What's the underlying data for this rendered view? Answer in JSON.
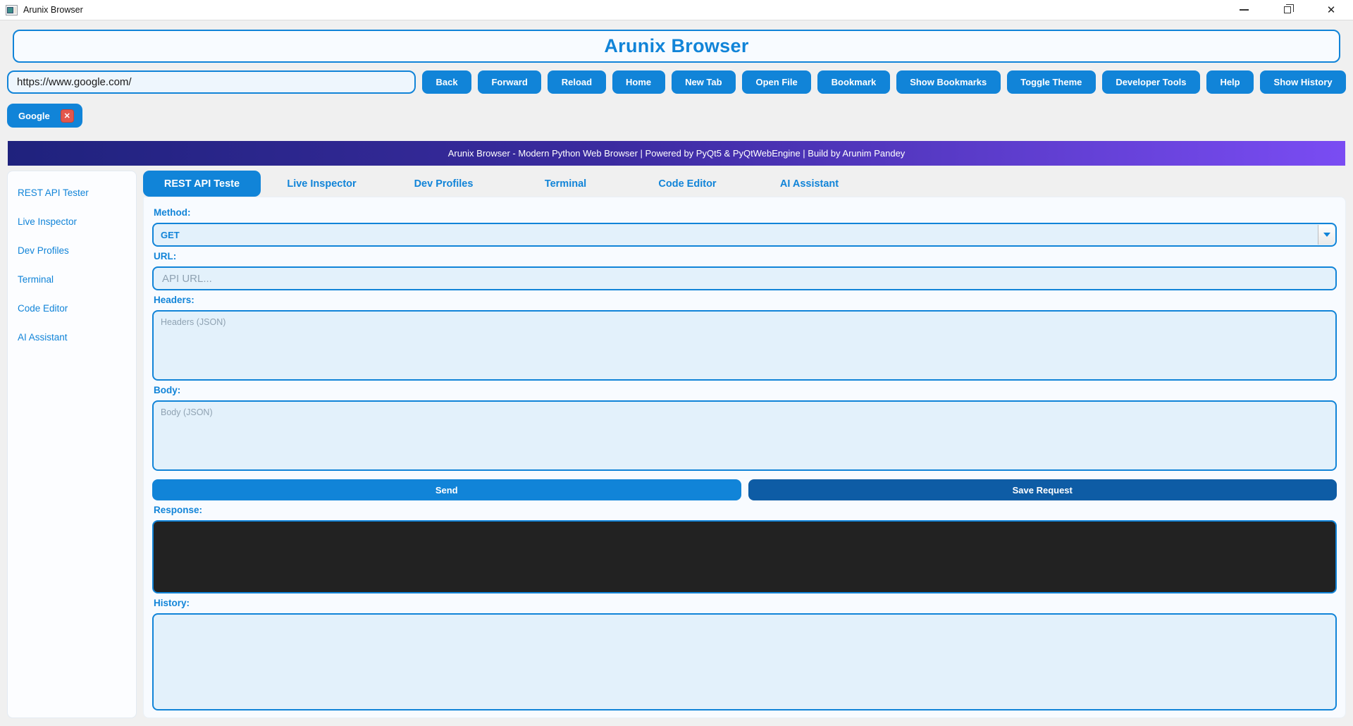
{
  "window": {
    "title": "Arunix Browser",
    "minimize_icon": "",
    "close_icon": "✕"
  },
  "header": {
    "app_title": "Arunix Browser"
  },
  "nav": {
    "url_value": "https://www.google.com/",
    "buttons": [
      "Back",
      "Forward",
      "Reload",
      "Home",
      "New Tab",
      "Open File",
      "Bookmark",
      "Show Bookmarks",
      "Toggle Theme",
      "Developer Tools",
      "Help",
      "Show History"
    ]
  },
  "page_tabs": {
    "active_tab_label": "Google",
    "close_glyph": "✕"
  },
  "banner": {
    "text": "Arunix Browser - Modern Python Web Browser | Powered by PyQt5 & PyQtWebEngine | Build by Arunim Pandey",
    "gradient_from": "#1f227d",
    "gradient_to": "#7a4cf3"
  },
  "sidebar": {
    "items": [
      {
        "label": "REST API Tester"
      },
      {
        "label": "Live Inspector"
      },
      {
        "label": "Dev Profiles"
      },
      {
        "label": "Terminal"
      },
      {
        "label": "Code Editor"
      },
      {
        "label": "AI Assistant"
      }
    ]
  },
  "main": {
    "tabs": [
      {
        "label": "REST API Teste",
        "selected": true
      },
      {
        "label": "Live Inspector",
        "selected": false
      },
      {
        "label": "Dev Profiles",
        "selected": false
      },
      {
        "label": "Terminal",
        "selected": false
      },
      {
        "label": "Code Editor",
        "selected": false
      },
      {
        "label": "AI Assistant",
        "selected": false
      }
    ],
    "form": {
      "method_label": "Method:",
      "method_value": "GET",
      "url_label": "URL:",
      "url_placeholder": "API URL...",
      "headers_label": "Headers:",
      "headers_placeholder": "Headers (JSON)",
      "body_label": "Body:",
      "body_placeholder": "Body (JSON)",
      "send_label": "Send",
      "save_label": "Save Request",
      "response_label": "Response:",
      "response_value": "",
      "history_label": "History:"
    }
  },
  "colors": {
    "accent": "#1184d8",
    "accent_dark": "#0e5ca5",
    "field_bg": "#e3f1fb",
    "response_bg": "#222222",
    "tab_close_bg": "#e2574d",
    "app_bg": "#f0f0f0"
  }
}
